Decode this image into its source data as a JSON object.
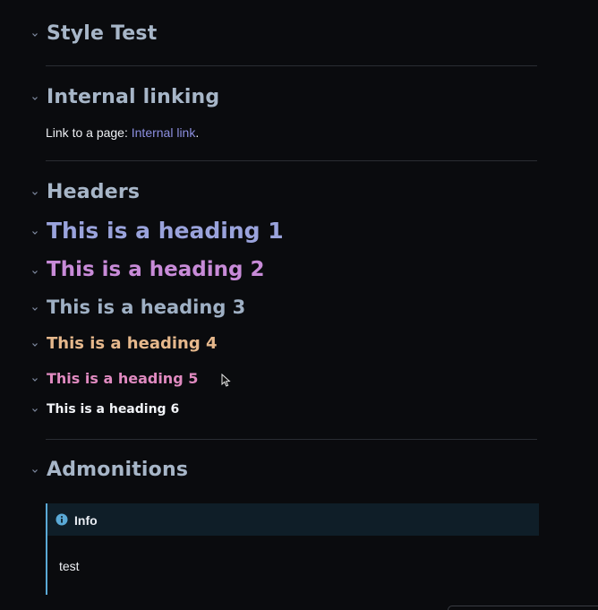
{
  "page": {
    "title": "Style Test",
    "sections": {
      "internal_linking": {
        "heading": "Internal linking",
        "text_before": "Link to a page: ",
        "link_label": "Internal link",
        "text_after": "."
      },
      "headers": {
        "heading": "Headers",
        "h1": "This is a heading 1",
        "h2": "This is a heading 2",
        "h3": "This is a heading 3",
        "h4": "This is a heading 4",
        "h5": "This is a heading 5",
        "h6": "This is a heading 6"
      },
      "admonitions": {
        "heading": "Admonitions",
        "admonition": {
          "type_icon": "info-icon",
          "title": "Info",
          "body": "test"
        }
      }
    }
  },
  "colors": {
    "background": "#0a0b0e",
    "heading_default": "#a7b6c8",
    "heading_1": "#9aa3dc",
    "heading_2": "#c88bd8",
    "heading_3": "#9fb0c4",
    "heading_4": "#e6b88c",
    "heading_5": "#e08ac0",
    "heading_6": "#f2f4f8",
    "link": "#8c8fe0",
    "admonition_accent": "#5aa9d6",
    "admonition_header_bg": "#0f1e28"
  },
  "icons": {
    "collapse": "chevron-down-icon",
    "cursor": "mouse-pointer-icon"
  }
}
